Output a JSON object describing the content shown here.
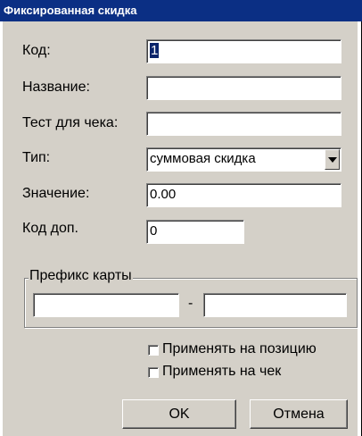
{
  "window": {
    "title": "Фиксированная скидка"
  },
  "form": {
    "code_label": "Код:",
    "code_value": "1",
    "name_label": "Название:",
    "name_value": "",
    "receipt_text_label": "Тест для чека:",
    "receipt_text_value": "",
    "type_label": "Тип:",
    "type_value": "суммовая скидка",
    "value_label": "Значение:",
    "value_value": "0.00",
    "extra_code_label": "Код доп.",
    "extra_code_value": "0"
  },
  "card_prefix": {
    "label": "Префикс карты",
    "from_value": "",
    "separator": "-",
    "to_value": ""
  },
  "options": {
    "apply_to_position_label": "Применять на позицию",
    "apply_to_position_checked": false,
    "apply_to_receipt_label": "Применять на чек",
    "apply_to_receipt_checked": false
  },
  "buttons": {
    "ok_label": "OK",
    "cancel_label": "Отмена"
  },
  "colors": {
    "titlebar": "#0b2f84",
    "dialog_face": "#d4d0c8",
    "selection": "#0a246a"
  }
}
